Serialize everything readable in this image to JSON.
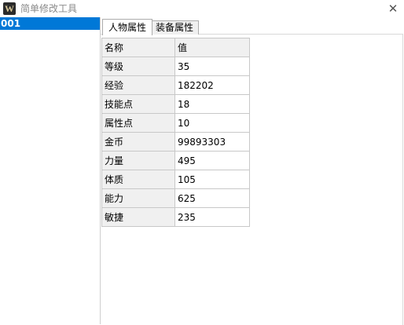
{
  "window": {
    "title": "简单修改工具",
    "icon_letter": "W",
    "close_symbol": "✕"
  },
  "left_list": {
    "items": [
      {
        "label": "001",
        "selected": true
      }
    ]
  },
  "tabs": [
    {
      "label": "人物属性",
      "active": true
    },
    {
      "label": "装备属性",
      "active": false
    }
  ],
  "grid": {
    "headers": [
      "名称",
      "值"
    ],
    "rows": [
      {
        "name": "等级",
        "value": "35"
      },
      {
        "name": "经验",
        "value": "182202"
      },
      {
        "name": "技能点",
        "value": "18"
      },
      {
        "name": "属性点",
        "value": "10"
      },
      {
        "name": "金币",
        "value": "99893303"
      },
      {
        "name": "力量",
        "value": "495"
      },
      {
        "name": "体质",
        "value": "105"
      },
      {
        "name": "能力",
        "value": "625"
      },
      {
        "name": "敏捷",
        "value": "235"
      }
    ]
  },
  "colors": {
    "selection": "#0078d7",
    "header_bg": "#f0f0f0",
    "grid_line": "#c8c8c8"
  }
}
